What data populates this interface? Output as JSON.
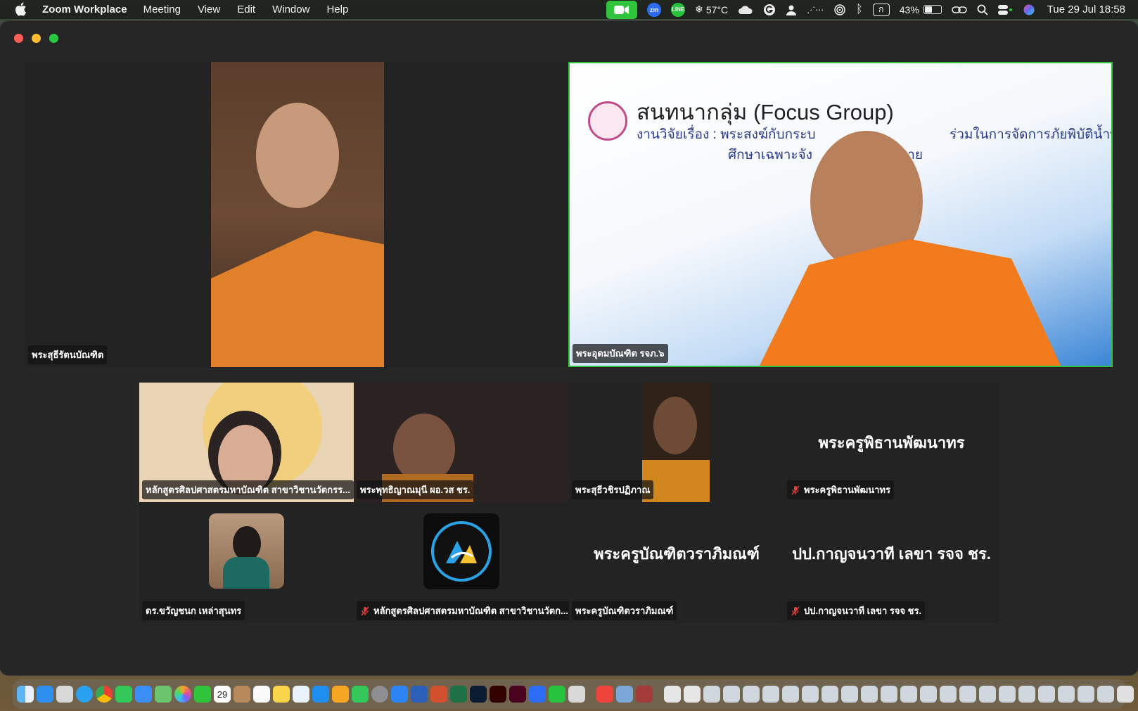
{
  "menubar": {
    "app_name": "Zoom Workplace",
    "menus": [
      "Meeting",
      "View",
      "Edit",
      "Window",
      "Help"
    ],
    "zoom_tray_label": "zm",
    "line_tray_label": "LINE",
    "temperature": "57°C",
    "input_source": "ก",
    "battery_percent": "43%",
    "battery_level": 0.43,
    "datetime": "Tue 29 Jul  18:58"
  },
  "meeting": {
    "top_tiles": [
      {
        "name": "พระสุธีรัตนบัณฑิต"
      },
      {
        "name": "พระอุดมบัณฑิต รจภ.๖",
        "active_speaker": true
      }
    ],
    "slide": {
      "title": "สนทนากลุ่ม (Focus Group)",
      "subtitle_line1": "งานวิจัยเรื่อง : พระสงฆ์กับกระบ",
      "subtitle_line1_right": "ร่วมในการจัดการภัยพิบัติน้ำท่วม",
      "subtitle_line2": "ศึกษาเฉพาะจัง",
      "subtitle_line2_right": "ราย"
    },
    "grid_row1": [
      {
        "name": "หลักสูตรศิลปศาสตรมหาบัณฑิต สาขาวิชานวัตกรร...",
        "muted": false
      },
      {
        "name": "พระพุทธิญาณมุนี ผอ.วส ชร.",
        "muted": false
      },
      {
        "name": "พระสุธีวชิรปฏิภาณ",
        "muted": false
      },
      {
        "name": "พระครูพิธานพัฒนาทร",
        "display_name": "พระครูพิธานพัฒนาทร",
        "muted": true
      }
    ],
    "grid_row2": [
      {
        "name": "ดร.ขวัญชนก เหล่าสุนทร",
        "muted": false
      },
      {
        "name": "หลักสูตรศิลปศาสตรมหาบัณฑิต สาขาวิชานวัตก...",
        "muted": true
      },
      {
        "name": "พระครูบัณฑิตวราภิมณฑ์",
        "display_name": "พระครูบัณฑิตวราภิมณฑ์",
        "muted": false
      },
      {
        "name": "ปป.กาญจนวาที เลขา รจจ ชร.",
        "display_name": "ปป.กาญจนวาที เลขา รจจ ชร.",
        "muted": true
      }
    ]
  },
  "dock": {
    "calendar_day": "29"
  },
  "colors": {
    "active_speaker_border": "#2fc43c",
    "robe": "#e0802a",
    "muted": "#e0403c"
  }
}
